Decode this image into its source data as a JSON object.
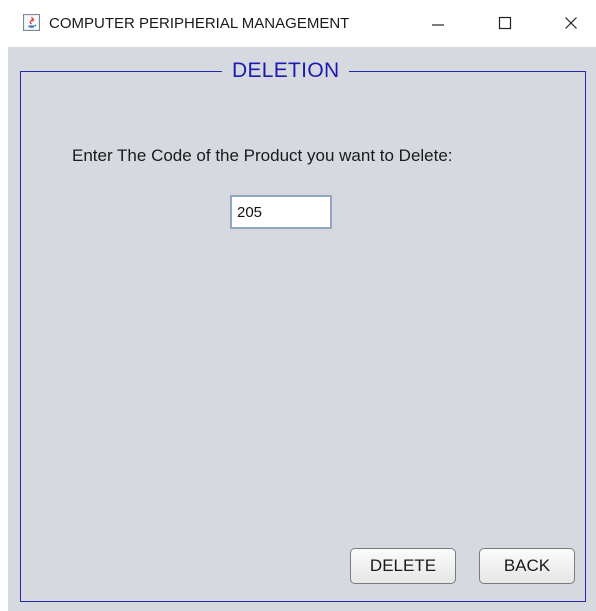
{
  "window": {
    "title": "COMPUTER PERIPHERIAL MANAGEMENT",
    "app_icon": "java-app-icon",
    "controls": {
      "minimize_icon": "minimize-icon",
      "maximize_icon": "maximize-icon",
      "close_icon": "close-icon"
    }
  },
  "panel": {
    "legend": "DELETION",
    "prompt": "Enter The Code of the Product you want to Delete:",
    "code_input": {
      "value": "205",
      "placeholder": ""
    }
  },
  "buttons": {
    "delete_label": "DELETE",
    "back_label": "BACK"
  },
  "colors": {
    "panel_background": "#d7d9e1",
    "border_accent": "#2727b0",
    "legend_text": "#1b1bb0"
  }
}
